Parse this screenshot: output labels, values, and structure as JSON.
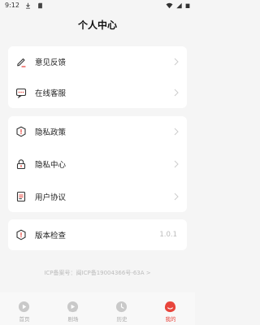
{
  "status": {
    "time": "9:12"
  },
  "header": {
    "title": "个人中心"
  },
  "cards": [
    {
      "items": [
        {
          "label": "意见反馈",
          "icon": "edit-icon"
        },
        {
          "label": "在线客服",
          "icon": "chat-icon"
        }
      ]
    },
    {
      "items": [
        {
          "label": "隐私政策",
          "icon": "shield-icon"
        },
        {
          "label": "隐私中心",
          "icon": "lock-icon"
        },
        {
          "label": "用户协议",
          "icon": "document-icon"
        }
      ]
    },
    {
      "items": [
        {
          "label": "版本检查",
          "icon": "alert-icon",
          "value": "1.0.1"
        }
      ]
    }
  ],
  "icp": "ICP备案号：闽ICP备19004366号-63A >",
  "tabs": [
    {
      "label": "首页",
      "icon": "play-icon"
    },
    {
      "label": "剧场",
      "icon": "theater-icon"
    },
    {
      "label": "历史",
      "icon": "clock-icon"
    },
    {
      "label": "我的",
      "icon": "profile-icon",
      "active": true
    }
  ],
  "colors": {
    "accent": "#e8453c",
    "icon": "#333333"
  }
}
